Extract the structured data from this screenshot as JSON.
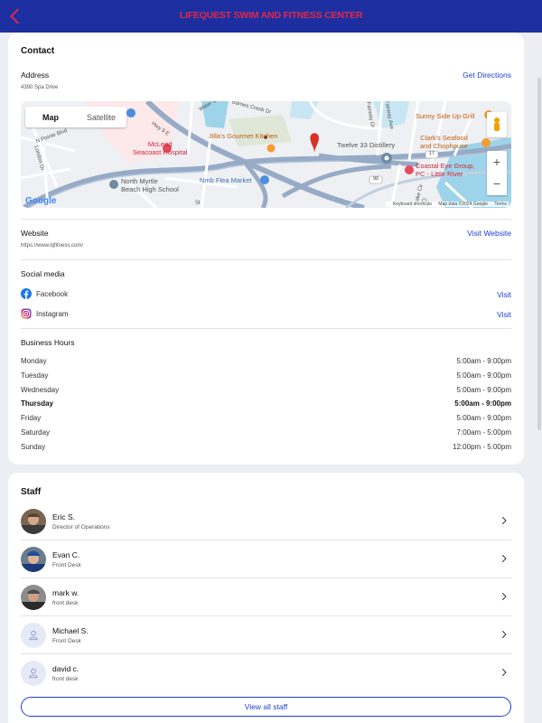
{
  "header": {
    "title": "LIFEQUEST SWIM AND FITNESS CENTER",
    "back_icon": "chevron-left-icon"
  },
  "contact": {
    "title": "Contact",
    "address_label": "Address",
    "address": "4390 Spa Drive",
    "directions_label": "Get Directions",
    "map": {
      "toggle_map": "Map",
      "toggle_satellite": "Satellite",
      "logo": "Google",
      "keyboard": "Keyboard shortcuts",
      "map_data": "Map data ©2024 Google",
      "terms": "Terms",
      "zoom_in": "+",
      "zoom_out": "−",
      "places": {
        "mcleod": "McLeod\nSeacoast Hospital",
        "jillas": "Jilla's Gourmet Kitchen",
        "twelve33": "Twelve 33 Distillery",
        "sunny": "Sunny Side Up Grill",
        "clarks": "Clark's Seafood\nand Chophouse",
        "coastal": "Coastal Eye Group,\nPC - Little River",
        "northmyrtle": "North Myrtle\nBeach High School",
        "flea": "Nmb Flea Market"
      },
      "streets": {
        "hwy9": "Hwy 9 E",
        "water": "Water Oak",
        "barnes": "Barnes Creek Dr",
        "fairway_ave": "Fairway Ave",
        "fairway_dr": "Fairway Dr",
        "n_pointe": "N Pointe Blvd",
        "london": "London Dr",
        "st": "St",
        "hwy17": "17",
        "hwy90": "90",
        "lake": "Lake Cir",
        "lake_circle": "Ci"
      }
    },
    "website_label": "Website",
    "website": "https://www.lqfitness.com/",
    "visit_website": "Visit Website",
    "social_label": "Social media",
    "social": [
      {
        "name": "Facebook",
        "action": "Visit",
        "icon": "facebook-icon",
        "color": "#1877f2"
      },
      {
        "name": "Instagram",
        "action": "Visit",
        "icon": "instagram-icon",
        "color": "#d62976"
      }
    ],
    "hours_label": "Business Hours",
    "hours": [
      {
        "day": "Monday",
        "time": "5:00am - 9:00pm"
      },
      {
        "day": "Tuesday",
        "time": "5:00am - 9:00pm"
      },
      {
        "day": "Wednesday",
        "time": "5:00am - 9:00pm"
      },
      {
        "day": "Thursday",
        "time": "5:00am - 9:00pm"
      },
      {
        "day": "Friday",
        "time": "5:00am - 9:00pm"
      },
      {
        "day": "Saturday",
        "time": "7:00am - 5:00pm"
      },
      {
        "day": "Sunday",
        "time": "12:00pm - 5:00pm"
      }
    ]
  },
  "staff": {
    "title": "Staff",
    "members": [
      {
        "name": "Eric S.",
        "role": "Director of Operations"
      },
      {
        "name": "Evan C.",
        "role": "Front Desk"
      },
      {
        "name": "mark w.",
        "role": "front desk"
      },
      {
        "name": "Michael S.",
        "role": "Front Desk"
      },
      {
        "name": "david c.",
        "role": "front desk"
      }
    ],
    "view_all": "View all staff"
  },
  "colors": {
    "brand": "#1d2fa0",
    "title": "#e0284a",
    "link": "#1f3fd6"
  }
}
